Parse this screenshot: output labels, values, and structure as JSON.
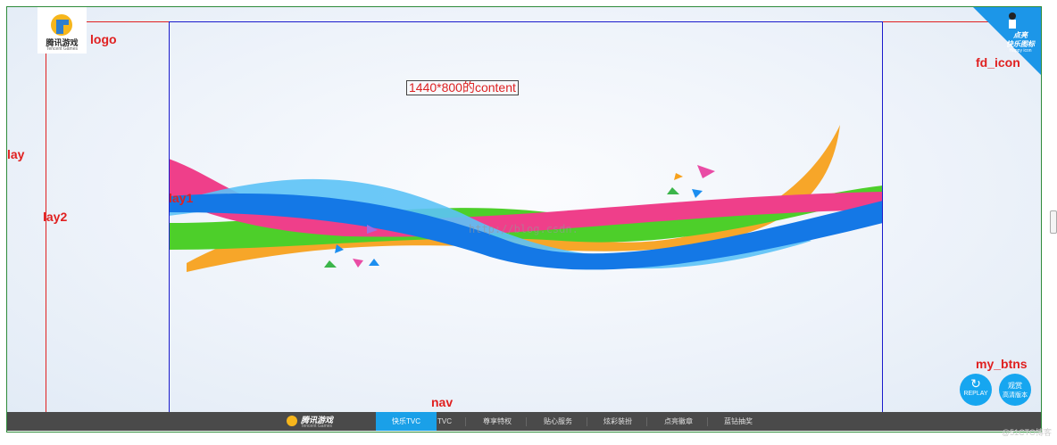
{
  "labels": {
    "logo": "logo",
    "fd_icon": "fd_icon",
    "lay": "lay",
    "lay2": "lay2",
    "lay1": "lay1",
    "my_btns": "my_btns",
    "nav": "nav",
    "content": "1440*800的content"
  },
  "logo": {
    "cn": "腾讯游戏",
    "en": "Tencent Games"
  },
  "fd_icon": {
    "line1": "点亮",
    "line2": "快乐图标",
    "line3": "Happy icon"
  },
  "watermark": "http://blog.csdn.",
  "buttons": {
    "replay": "REPLAY",
    "hd_line1": "观赏",
    "hd_line2": "高清版本"
  },
  "nav": {
    "logo_cn": "腾讯游戏",
    "logo_en": "Tencent Games",
    "items": [
      "快乐TVC",
      "TVC",
      "尊享特权",
      "贴心服务",
      "炫彩装扮",
      "点亮徽章",
      "蓝钻抽奖"
    ]
  },
  "site_watermark": "@51CTO博客",
  "colors": {
    "accent": "#1aa0e8",
    "annotation": "#e02020",
    "content_border": "#1a1acc",
    "lay_border": "#2e8b3a"
  }
}
